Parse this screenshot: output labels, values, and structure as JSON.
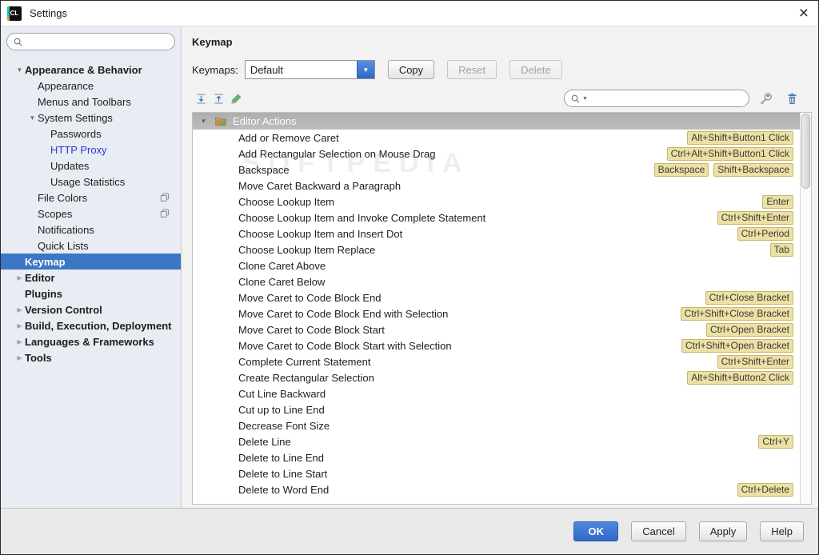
{
  "window": {
    "title": "Settings",
    "app_icon_text": "CL",
    "close_glyph": "×"
  },
  "colors": {
    "selection_blue": "#3d76c4",
    "accent_blue": "#3268c6",
    "badge_bg": "#ece0a7",
    "badge_border": "#c9b76b",
    "sidebar_bg": "#e7edf3",
    "group_header_bg": "#b5b5b5",
    "highlight_link": "#2b35d8"
  },
  "sidebar": {
    "search": {
      "value": "",
      "placeholder": ""
    },
    "items": [
      {
        "label": "Appearance & Behavior",
        "level": 0,
        "bold": true,
        "state": "expanded"
      },
      {
        "label": "Appearance",
        "level": 1
      },
      {
        "label": "Menus and Toolbars",
        "level": 1
      },
      {
        "label": "System Settings",
        "level": 1,
        "state": "expanded"
      },
      {
        "label": "Passwords",
        "level": 2
      },
      {
        "label": "HTTP Proxy",
        "level": 2,
        "highlighted": true
      },
      {
        "label": "Updates",
        "level": 2
      },
      {
        "label": "Usage Statistics",
        "level": 2
      },
      {
        "label": "File Colors",
        "level": 1,
        "badge_icon": "copy-icon"
      },
      {
        "label": "Scopes",
        "level": 1,
        "badge_icon": "copy-icon"
      },
      {
        "label": "Notifications",
        "level": 1
      },
      {
        "label": "Quick Lists",
        "level": 1
      },
      {
        "label": "Keymap",
        "level": 0,
        "bold": true,
        "selected": true
      },
      {
        "label": "Editor",
        "level": 0,
        "bold": true,
        "state": "collapsed"
      },
      {
        "label": "Plugins",
        "level": 0,
        "bold": true
      },
      {
        "label": "Version Control",
        "level": 0,
        "bold": true,
        "state": "collapsed"
      },
      {
        "label": "Build, Execution, Deployment",
        "level": 0,
        "bold": true,
        "state": "collapsed"
      },
      {
        "label": "Languages & Frameworks",
        "level": 0,
        "bold": true,
        "state": "collapsed"
      },
      {
        "label": "Tools",
        "level": 0,
        "bold": true,
        "state": "collapsed"
      }
    ]
  },
  "header": {
    "page_title": "Keymap",
    "keymaps_label": "Keymaps:",
    "keymap_selected": "Default",
    "copy_label": "Copy",
    "reset_label": "Reset",
    "delete_label": "Delete"
  },
  "toolbar": {
    "search": {
      "value": "",
      "placeholder": ""
    }
  },
  "watermark": "SOFTPEDIA",
  "actions_tree": {
    "group_label": "Editor Actions",
    "rows": [
      {
        "label": "Add or Remove Caret",
        "shortcuts": [
          "Alt+Shift+Button1 Click"
        ]
      },
      {
        "label": "Add Rectangular Selection on Mouse Drag",
        "shortcuts": [
          "Ctrl+Alt+Shift+Button1 Click"
        ]
      },
      {
        "label": "Backspace",
        "shortcuts": [
          "Backspace",
          "Shift+Backspace"
        ]
      },
      {
        "label": "Move Caret Backward a Paragraph",
        "shortcuts": []
      },
      {
        "label": "Choose Lookup Item",
        "shortcuts": [
          "Enter"
        ]
      },
      {
        "label": "Choose Lookup Item and Invoke Complete Statement",
        "shortcuts": [
          "Ctrl+Shift+Enter"
        ]
      },
      {
        "label": "Choose Lookup Item and Insert Dot",
        "shortcuts": [
          "Ctrl+Period"
        ]
      },
      {
        "label": "Choose Lookup Item Replace",
        "shortcuts": [
          "Tab"
        ]
      },
      {
        "label": "Clone Caret Above",
        "shortcuts": []
      },
      {
        "label": "Clone Caret Below",
        "shortcuts": []
      },
      {
        "label": "Move Caret to Code Block End",
        "shortcuts": [
          "Ctrl+Close Bracket"
        ]
      },
      {
        "label": "Move Caret to Code Block End with Selection",
        "shortcuts": [
          "Ctrl+Shift+Close Bracket"
        ]
      },
      {
        "label": "Move Caret to Code Block Start",
        "shortcuts": [
          "Ctrl+Open Bracket"
        ]
      },
      {
        "label": "Move Caret to Code Block Start with Selection",
        "shortcuts": [
          "Ctrl+Shift+Open Bracket"
        ]
      },
      {
        "label": "Complete Current Statement",
        "shortcuts": [
          "Ctrl+Shift+Enter"
        ]
      },
      {
        "label": "Create Rectangular Selection",
        "shortcuts": [
          "Alt+Shift+Button2 Click"
        ]
      },
      {
        "label": "Cut Line Backward",
        "shortcuts": []
      },
      {
        "label": "Cut up to Line End",
        "shortcuts": []
      },
      {
        "label": "Decrease Font Size",
        "shortcuts": []
      },
      {
        "label": "Delete Line",
        "shortcuts": [
          "Ctrl+Y"
        ]
      },
      {
        "label": "Delete to Line End",
        "shortcuts": []
      },
      {
        "label": "Delete to Line Start",
        "shortcuts": []
      },
      {
        "label": "Delete to Word End",
        "shortcuts": [
          "Ctrl+Delete"
        ]
      }
    ]
  },
  "footer": {
    "ok_label": "OK",
    "cancel_label": "Cancel",
    "apply_label": "Apply",
    "help_label": "Help"
  }
}
